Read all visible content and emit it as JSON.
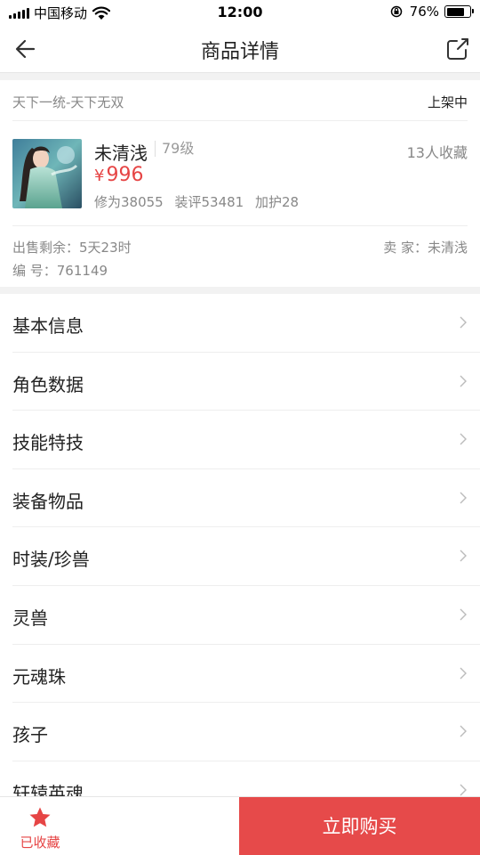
{
  "status_bar": {
    "carrier": "中国移动",
    "time": "12:00",
    "battery_text": "76%",
    "battery_level": 0.76
  },
  "nav": {
    "title": "商品详情",
    "back_icon": "arrow-left-icon",
    "share_icon": "share-icon"
  },
  "product": {
    "server": "天下一统-天下无双",
    "listing_status": "上架中",
    "role_name": "未清浅",
    "level": "79级",
    "favorites": "13人收藏",
    "price_symbol": "¥",
    "price": "996",
    "stats": [
      "修为38055",
      "装评53481",
      "加护28"
    ],
    "sell_remaining": "出售剩余：5天23时",
    "seller": "卖 家：未清浅",
    "item_number": "编 号：761149"
  },
  "menu": {
    "items": [
      {
        "label": "基本信息"
      },
      {
        "label": "角色数据"
      },
      {
        "label": "技能特技"
      },
      {
        "label": "装备物品"
      },
      {
        "label": "时装/珍兽"
      },
      {
        "label": "灵兽"
      },
      {
        "label": "元魂珠"
      },
      {
        "label": "孩子"
      },
      {
        "label": "轩辕英魂"
      }
    ]
  },
  "bottom_bar": {
    "favorite_label": "已收藏",
    "buy_label": "立即购买"
  },
  "colors": {
    "accent": "#e64545",
    "buy_button": "#e64a4a"
  }
}
